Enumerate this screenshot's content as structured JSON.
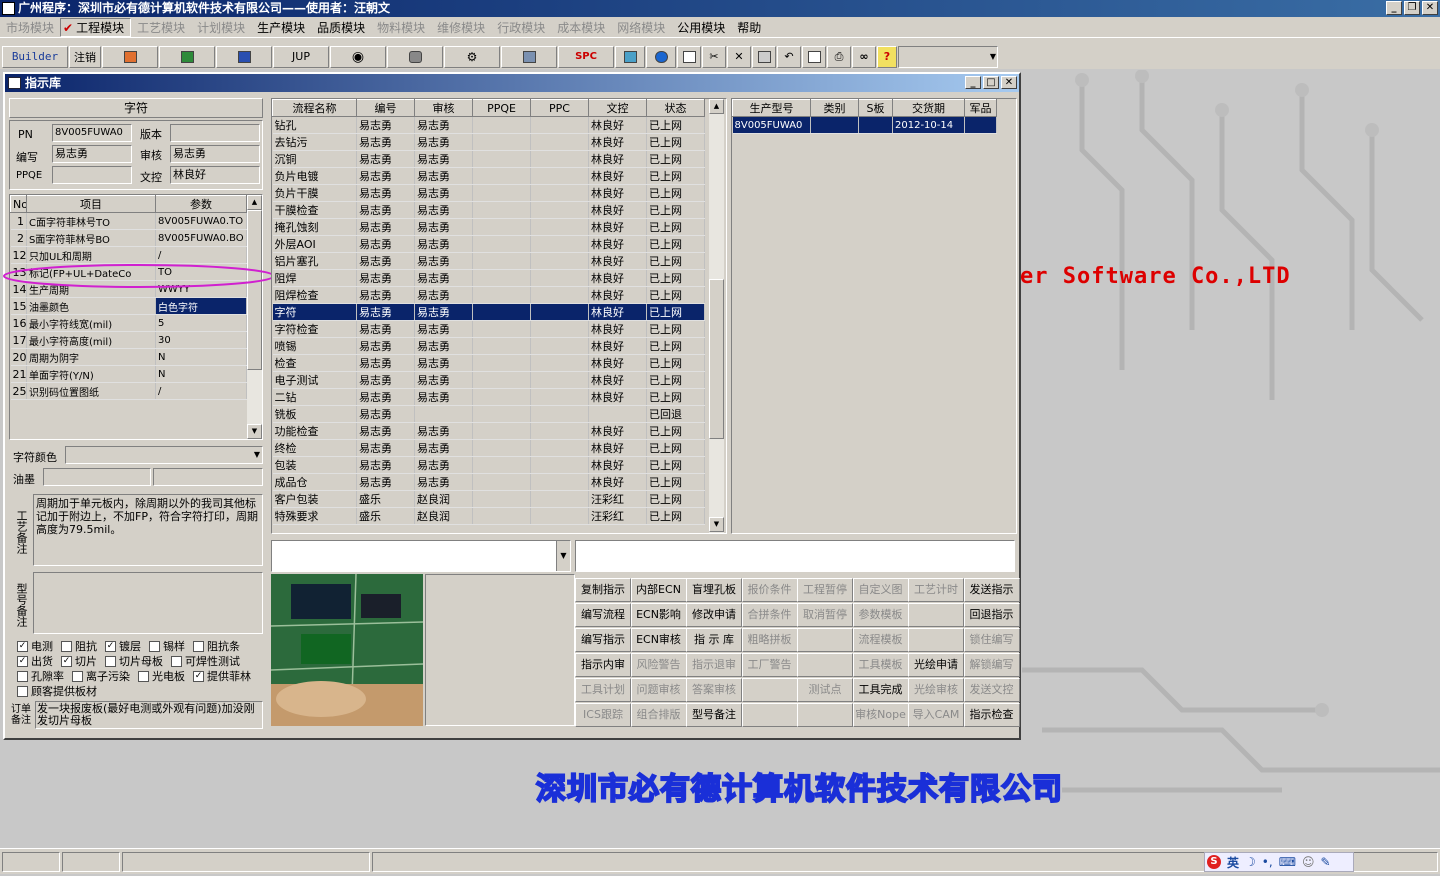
{
  "app": {
    "title": "广州程序：深圳市必有德计算机软件技术有限公司——使用者：汪朝文"
  },
  "menu": [
    {
      "label": "市场模块",
      "disabled": true
    },
    {
      "label": "工程模块",
      "checked": true
    },
    {
      "label": "工艺模块",
      "disabled": true
    },
    {
      "label": "计划模块",
      "disabled": true
    },
    {
      "label": "生产模块"
    },
    {
      "label": "品质模块"
    },
    {
      "label": "物料模块",
      "disabled": true
    },
    {
      "label": "维修模块",
      "disabled": true
    },
    {
      "label": "行政模块",
      "disabled": true
    },
    {
      "label": "成本模块",
      "disabled": true
    },
    {
      "label": "网络模块",
      "disabled": true
    },
    {
      "label": "公用模块"
    },
    {
      "label": "帮助"
    }
  ],
  "toolbar": {
    "builder": "Builder",
    "logout": "注销",
    "jup": "JUP",
    "spc": "SPC",
    "help": "?"
  },
  "background": {
    "brand": "er Software Co.,LTD",
    "company": "深圳市必有德计算机软件技术有限公司"
  },
  "window": {
    "title": "指示库"
  },
  "left": {
    "section_title": "字符",
    "pn_label": "PN",
    "pn_value": "8V005FUWA0",
    "version_label": "版本",
    "version_value": "",
    "author_label": "编写",
    "author_value": "易志勇",
    "review_label": "审核",
    "review_value": "易志勇",
    "ppqe_label": "PPQE",
    "ppqe_value": "",
    "control_label": "文控",
    "control_value": "林良好",
    "params_headers": [
      "No",
      "项目",
      "参数"
    ],
    "params": [
      {
        "no": "1",
        "item": "C面字符菲林号TO",
        "value": "8V005FUWA0.TO"
      },
      {
        "no": "2",
        "item": "S面字符菲林号BO",
        "value": "8V005FUWA0.BO"
      },
      {
        "no": "12",
        "item": "只加UL和周期",
        "value": "/"
      },
      {
        "no": "13",
        "item": "标记(FP+UL+DateCo",
        "value": "TO"
      },
      {
        "no": "14",
        "item": "生产周期",
        "value": "WWYY"
      },
      {
        "no": "15",
        "item": "油墨颜色",
        "value": "白色字符"
      },
      {
        "no": "16",
        "item": "最小字符线宽(mil)",
        "value": "5"
      },
      {
        "no": "17",
        "item": "最小字符高度(mil)",
        "value": "30"
      },
      {
        "no": "20",
        "item": "周期为阴字",
        "value": "N"
      },
      {
        "no": "21",
        "item": "单面字符(Y/N)",
        "value": "N"
      },
      {
        "no": "25",
        "item": "识别码位置图纸",
        "value": "/"
      }
    ],
    "char_color_label": "字符颜色",
    "ink_label": "油墨",
    "process_note_label": "工艺备注",
    "process_note": "周期加于单元板内，除周期以外的我司其他标记加于附边上，不加FP，符合字符打印，周期高度为79.5mil。",
    "model_note_label": "型号备注",
    "model_note": "",
    "checks": [
      [
        {
          "label": "电测",
          "checked": true
        },
        {
          "label": "阻抗",
          "checked": false
        },
        {
          "label": "镀层",
          "checked": true
        },
        {
          "label": "锡样",
          "checked": false
        },
        {
          "label": "阻抗条",
          "checked": false
        }
      ],
      [
        {
          "label": "出货",
          "checked": true
        },
        {
          "label": "切片",
          "checked": true
        },
        {
          "label": "切片母板",
          "checked": false
        },
        {
          "label": "可焊性测试",
          "checked": false
        }
      ],
      [
        {
          "label": "孔隙率",
          "checked": false
        },
        {
          "label": "离子污染",
          "checked": false
        },
        {
          "label": "光电板",
          "checked": false
        },
        {
          "label": "提供菲林",
          "checked": true
        }
      ],
      [
        {
          "label": "顾客提供板材",
          "checked": false
        }
      ]
    ],
    "order_note_label": "订单备注",
    "order_note": "发一块报废板(最好电测或外观有问题)加没刚发切片母板"
  },
  "flow": {
    "headers": [
      "流程名称",
      "编号",
      "审核",
      "PPQE",
      "PPC",
      "文控",
      "状态"
    ],
    "rows": [
      [
        "钻孔",
        "易志勇",
        "易志勇",
        "",
        "",
        "林良好",
        "已上网"
      ],
      [
        "去钻污",
        "易志勇",
        "易志勇",
        "",
        "",
        "林良好",
        "已上网"
      ],
      [
        "沉铜",
        "易志勇",
        "易志勇",
        "",
        "",
        "林良好",
        "已上网"
      ],
      [
        "负片电镀",
        "易志勇",
        "易志勇",
        "",
        "",
        "林良好",
        "已上网"
      ],
      [
        "负片干膜",
        "易志勇",
        "易志勇",
        "",
        "",
        "林良好",
        "已上网"
      ],
      [
        "干膜检查",
        "易志勇",
        "易志勇",
        "",
        "",
        "林良好",
        "已上网"
      ],
      [
        "掩孔蚀刻",
        "易志勇",
        "易志勇",
        "",
        "",
        "林良好",
        "已上网"
      ],
      [
        "外层AOI",
        "易志勇",
        "易志勇",
        "",
        "",
        "林良好",
        "已上网"
      ],
      [
        "铝片塞孔",
        "易志勇",
        "易志勇",
        "",
        "",
        "林良好",
        "已上网"
      ],
      [
        "阻焊",
        "易志勇",
        "易志勇",
        "",
        "",
        "林良好",
        "已上网"
      ],
      [
        "阻焊检查",
        "易志勇",
        "易志勇",
        "",
        "",
        "林良好",
        "已上网"
      ],
      [
        "字符",
        "易志勇",
        "易志勇",
        "",
        "",
        "林良好",
        "已上网"
      ],
      [
        "字符检查",
        "易志勇",
        "易志勇",
        "",
        "",
        "林良好",
        "已上网"
      ],
      [
        "喷锡",
        "易志勇",
        "易志勇",
        "",
        "",
        "林良好",
        "已上网"
      ],
      [
        "检查",
        "易志勇",
        "易志勇",
        "",
        "",
        "林良好",
        "已上网"
      ],
      [
        "电子测试",
        "易志勇",
        "易志勇",
        "",
        "",
        "林良好",
        "已上网"
      ],
      [
        "二钻",
        "易志勇",
        "易志勇",
        "",
        "",
        "林良好",
        "已上网"
      ],
      [
        "铣板",
        "易志勇",
        "",
        "",
        "",
        "",
        "已回退"
      ],
      [
        "功能检查",
        "易志勇",
        "易志勇",
        "",
        "",
        "林良好",
        "已上网"
      ],
      [
        "终检",
        "易志勇",
        "易志勇",
        "",
        "",
        "林良好",
        "已上网"
      ],
      [
        "包装",
        "易志勇",
        "易志勇",
        "",
        "",
        "林良好",
        "已上网"
      ],
      [
        "成品仓",
        "易志勇",
        "易志勇",
        "",
        "",
        "林良好",
        "已上网"
      ],
      [
        "客户包装",
        "盛乐",
        "赵良润",
        "",
        "",
        "汪彩红",
        "已上网"
      ],
      [
        "特殊要求",
        "盛乐",
        "赵良润",
        "",
        "",
        "汪彩红",
        "已上网"
      ]
    ],
    "selected": 11
  },
  "orders": {
    "headers": [
      "生产型号",
      "类别",
      "S板",
      "交货期",
      "军品"
    ],
    "rows": [
      [
        "8V005FUWA0",
        "",
        "",
        "2012-10-14",
        ""
      ]
    ]
  },
  "actions": [
    [
      {
        "label": "复制指示"
      },
      {
        "label": "内部ECN"
      },
      {
        "label": "盲埋孔板"
      },
      {
        "label": "报价条件",
        "disabled": true
      },
      {
        "label": "工程暂停",
        "disabled": true
      },
      {
        "label": "自定义图",
        "disabled": true
      },
      {
        "label": "工艺计时",
        "disabled": true
      },
      {
        "label": "发送指示"
      }
    ],
    [
      {
        "label": "编写流程"
      },
      {
        "label": "ECN影响"
      },
      {
        "label": "修改申请"
      },
      {
        "label": "合拼条件",
        "disabled": true
      },
      {
        "label": "取消暂停",
        "disabled": true
      },
      {
        "label": "参数模板",
        "disabled": true
      },
      {
        "label": ""
      },
      {
        "label": "回退指示"
      }
    ],
    [
      {
        "label": "编写指示"
      },
      {
        "label": "ECN审核"
      },
      {
        "label": "指 示 库"
      },
      {
        "label": "粗略拼板",
        "disabled": true
      },
      {
        "label": ""
      },
      {
        "label": "流程模板",
        "disabled": true
      },
      {
        "label": ""
      },
      {
        "label": "锁住编写",
        "disabled": true
      }
    ],
    [
      {
        "label": "指示内审"
      },
      {
        "label": "风险警告",
        "disabled": true
      },
      {
        "label": "指示退审",
        "disabled": true
      },
      {
        "label": "工厂警告",
        "disabled": true
      },
      {
        "label": ""
      },
      {
        "label": "工具模板",
        "disabled": true
      },
      {
        "label": "光绘申请"
      },
      {
        "label": "解锁编写",
        "disabled": true
      }
    ],
    [
      {
        "label": "工具计划",
        "disabled": true
      },
      {
        "label": "问题审核",
        "disabled": true
      },
      {
        "label": "答案审核",
        "disabled": true
      },
      {
        "label": ""
      },
      {
        "label": "测试点",
        "disabled": true
      },
      {
        "label": "工具完成"
      },
      {
        "label": "光绘审核",
        "disabled": true
      },
      {
        "label": "发送文控",
        "disabled": true
      }
    ],
    [
      {
        "label": "ICS跟踪",
        "disabled": true
      },
      {
        "label": "组合排版",
        "disabled": true
      },
      {
        "label": "型号备注"
      },
      {
        "label": ""
      },
      {
        "label": ""
      },
      {
        "label": "审核Nope",
        "disabled": true
      },
      {
        "label": "导入CAM",
        "disabled": true
      },
      {
        "label": "指示检查"
      }
    ]
  ],
  "colors": {
    "titlebar": "#0a246a",
    "selection": "#0a246a",
    "annotation": "#d020d0",
    "brand": "#dd0000",
    "company_stroke": "#1a2fd8"
  },
  "ime": {
    "label": "英"
  }
}
